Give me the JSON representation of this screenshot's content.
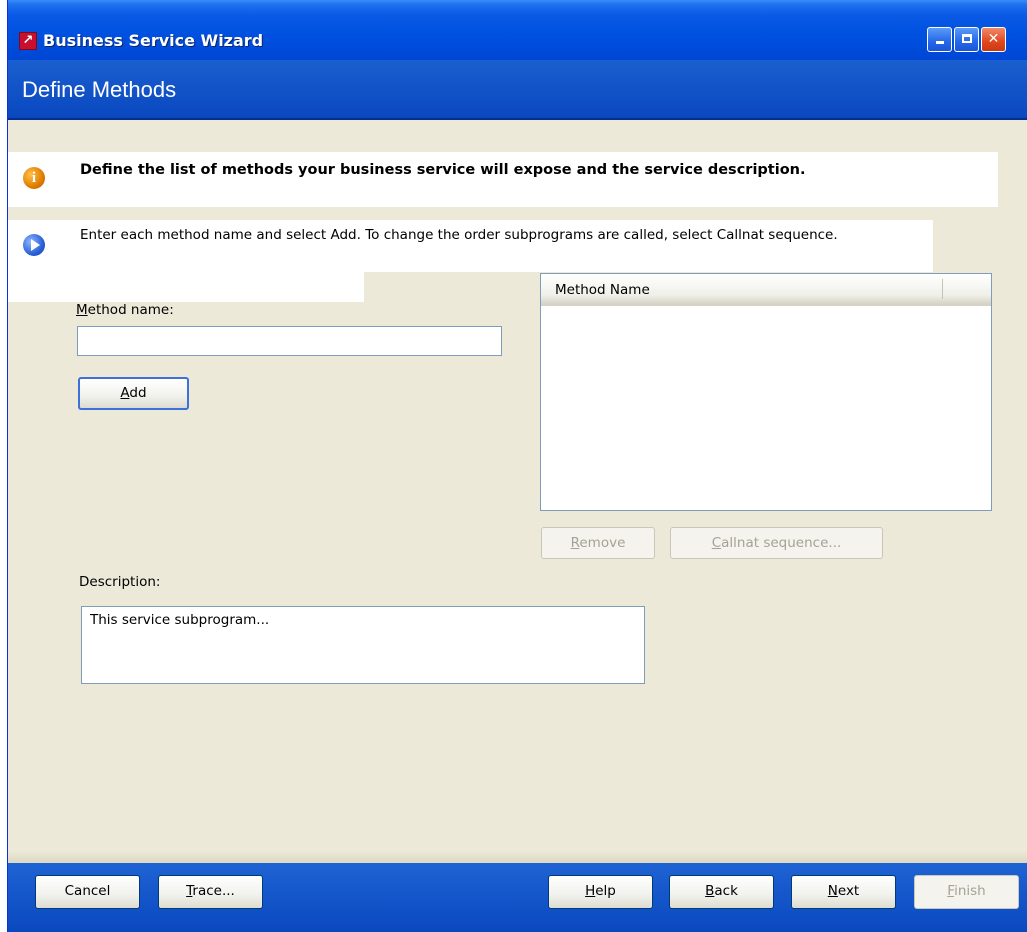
{
  "window": {
    "title": "Business Service Wizard",
    "app_icon": "wizard-app-icon"
  },
  "header": {
    "title": "Define Methods"
  },
  "info": {
    "icon": "info-icon",
    "text": "Define the list of methods your business service will expose and the service description."
  },
  "instruction": {
    "icon": "arrow-right-icon",
    "text": "Enter each method name and select Add. To change the order subprograms are called, select Callnat sequence."
  },
  "method_name": {
    "label_accel": "M",
    "label_rest": "ethod name:",
    "value": ""
  },
  "add_button": {
    "accel": "A",
    "rest": "dd"
  },
  "methods_list": {
    "column_header": "Method Name",
    "items": []
  },
  "remove_button": {
    "accel": "R",
    "rest": "emove",
    "enabled": false
  },
  "callnat_button": {
    "accel": "C",
    "rest": "allnat sequence...",
    "enabled": false
  },
  "description": {
    "label": "Description:",
    "value": "This service subprogram..."
  },
  "footer": {
    "cancel": "Cancel",
    "trace_accel": "T",
    "trace_rest": "race...",
    "help_accel": "H",
    "help_rest": "elp",
    "back_accel": "B",
    "back_rest": "ack",
    "next_accel": "N",
    "next_rest": "ext",
    "finish_accel": "F",
    "finish_rest": "inish",
    "finish_enabled": false
  },
  "colors": {
    "title_blue": "#0050e0",
    "dialog_face": "#ece9d8",
    "disabled_text": "#a5a394"
  }
}
